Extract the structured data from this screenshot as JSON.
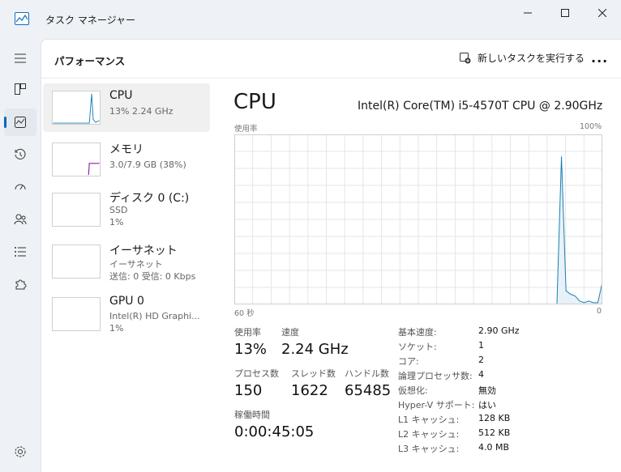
{
  "window": {
    "title": "タスク マネージャー"
  },
  "header": {
    "title": "パフォーマンス",
    "run_new_task": "新しいタスクを実行する",
    "more": "..."
  },
  "resources": [
    {
      "name": "CPU",
      "sub1": "13%  2.24 GHz",
      "sub2": "",
      "sub3": ""
    },
    {
      "name": "メモリ",
      "sub1": "3.0/7.9 GB (38%)",
      "sub2": "",
      "sub3": ""
    },
    {
      "name": "ディスク 0 (C:)",
      "sub1": "SSD",
      "sub2": "1%",
      "sub3": ""
    },
    {
      "name": "イーサネット",
      "sub1": "イーサネット",
      "sub2": "送信: 0 受信: 0 Kbps",
      "sub3": ""
    },
    {
      "name": "GPU 0",
      "sub1": "Intel(R) HD Graphi...",
      "sub2": "1%",
      "sub3": ""
    }
  ],
  "detail": {
    "title": "CPU",
    "model": "Intel(R) Core(TM) i5-4570T CPU @ 2.90GHz",
    "usage_label": "使用率",
    "max_label": "100%",
    "time_left_label": "60 秒",
    "time_right_label": "0"
  },
  "stats": {
    "usage_label": "使用率",
    "usage_value": "13%",
    "speed_label": "速度",
    "speed_value": "2.24 GHz",
    "processes_label": "プロセス数",
    "processes_value": "150",
    "threads_label": "スレッド数",
    "threads_value": "1622",
    "handles_label": "ハンドル数",
    "handles_value": "65485",
    "uptime_label": "稼働時間",
    "uptime_value": "0:00:45:05"
  },
  "specs": [
    {
      "label": "基本速度:",
      "value": "2.90 GHz"
    },
    {
      "label": "ソケット:",
      "value": "1"
    },
    {
      "label": "コア:",
      "value": "2"
    },
    {
      "label": "論理プロセッサ数:",
      "value": "4"
    },
    {
      "label": "仮想化:",
      "value": "無効"
    },
    {
      "label": "Hyper-V サポート:",
      "value": "はい"
    },
    {
      "label": "L1 キャッシュ:",
      "value": "128 KB"
    },
    {
      "label": "L2 キャッシュ:",
      "value": "512 KB"
    },
    {
      "label": "L3 キャッシュ:",
      "value": "4.0 MB"
    }
  ],
  "cpu_usage_history": [
    0,
    0,
    0,
    0,
    0,
    0,
    0,
    0,
    0,
    0,
    0,
    0,
    0,
    0,
    0,
    0,
    0,
    0,
    0,
    0,
    0,
    0,
    0,
    0,
    0,
    0,
    0,
    0,
    0,
    0,
    0,
    0,
    0,
    0,
    0,
    0,
    0,
    0,
    0,
    0,
    0,
    0,
    0,
    0,
    0,
    0,
    0,
    0,
    0,
    0,
    0,
    0,
    0,
    0,
    0,
    0,
    0,
    0,
    0,
    0,
    0,
    0,
    0,
    0,
    0,
    0,
    0,
    0,
    0,
    0,
    0,
    0,
    87,
    8,
    6,
    5,
    2,
    1,
    2,
    1,
    1,
    13
  ],
  "colors": {
    "accent": "#0067c0",
    "cpu_line": "#1a7fb7",
    "cpu_fill": "#e8f1f8",
    "memory_line": "#8b1fa3",
    "grid": "#e6e6e6"
  }
}
